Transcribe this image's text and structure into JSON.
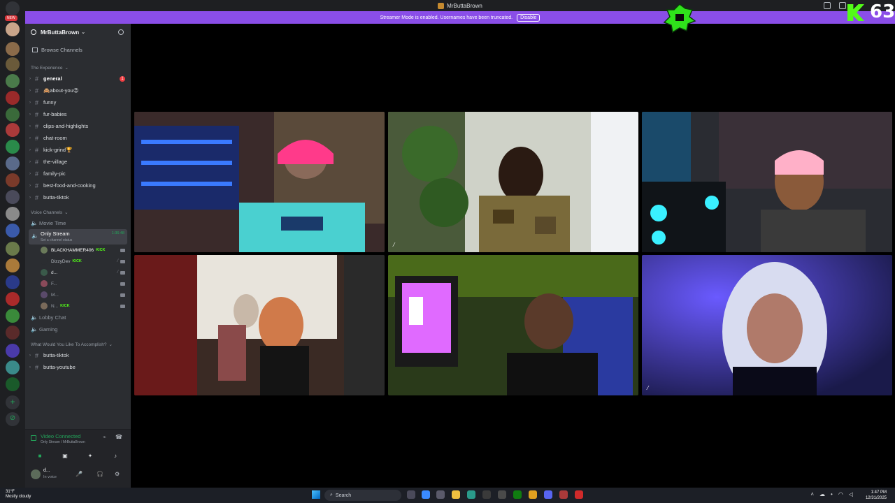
{
  "window": {
    "title": "MrButtaBrown"
  },
  "banner": {
    "text": "Streamer Mode is enabled. Usernames have been truncated.",
    "disable_label": "Disable"
  },
  "overlay": {
    "kick_count": "63"
  },
  "server_rail": {
    "new_badge": "NEW"
  },
  "server": {
    "name": "MrButtaBrown",
    "browse_channels": "Browse Channels",
    "categories": [
      {
        "label": "The Experience",
        "channels": [
          {
            "name": "general",
            "mention": "1"
          },
          {
            "name": "🙈about-you😡"
          },
          {
            "name": "funny"
          },
          {
            "name": "fur-babies"
          },
          {
            "name": "clips-and-highlights"
          },
          {
            "name": "chat-room"
          },
          {
            "name": "kick-grind🏆"
          },
          {
            "name": "the-village"
          },
          {
            "name": "family-pic"
          },
          {
            "name": "best-food-and-cooking"
          },
          {
            "name": "butta-tiktok"
          }
        ]
      },
      {
        "label": "Voice Channels"
      },
      {
        "label": "What Would You Like To Accomplish?",
        "channels": [
          {
            "name": "butta-tiktok"
          },
          {
            "name": "butta-youtube"
          }
        ]
      }
    ],
    "voice_channels": {
      "movie_time": "Movie Time",
      "active": {
        "name": "Only Stream",
        "status": "Set a channel status",
        "timer": "1:36:48"
      },
      "members": [
        {
          "name": "BLACKHAMMER406",
          "badge": "KICK"
        },
        {
          "name": "DizzyDev",
          "badge": "KICK"
        },
        {
          "name": "d..."
        },
        {
          "name": "F..."
        },
        {
          "name": "M..."
        },
        {
          "name": "N...",
          "badge": "KICK"
        }
      ],
      "lobby_chat": "Lobby Chat",
      "gaming": "Gaming"
    }
  },
  "voice_panel": {
    "status": "Video Connected",
    "location": "Only Stream / MrButtaBrown"
  },
  "user_panel": {
    "name": "d...",
    "status": "In voice"
  },
  "taskbar": {
    "weather_temp": "31°F",
    "weather_desc": "Mostly cloudy",
    "search_placeholder": "Search",
    "time": "1:47 PM",
    "date": "12/31/2025"
  },
  "colors": {
    "accent": "#5865f2",
    "banner": "#8a4ee8",
    "speaking": "#23a55a",
    "kick": "#53fc18"
  }
}
